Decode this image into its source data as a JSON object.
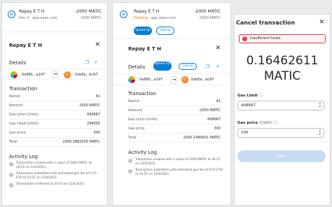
{
  "header": {
    "title": "Repay E T H",
    "amount": "-2000 MATIC",
    "date_site": "Dec 4 · app.aave.com",
    "sub_amount": "-2000 MATIC",
    "pending": "Pending",
    "site": "app.aave.com",
    "speed_up": "Speed Up",
    "cancel": "Cancel"
  },
  "details": {
    "title": "Repay E T H",
    "section": "Details",
    "from": "0x880...a197",
    "to": "0xbEa...dc97",
    "speed_up": "Speed Up",
    "cancel": "Cancel"
  },
  "transaction": {
    "title": "Transaction",
    "rows": [
      {
        "label": "Nonce",
        "value": "41"
      },
      {
        "label": "Amount",
        "value": "-2000 MATIC"
      },
      {
        "label": "Gas Limit (Units)",
        "value": "499667"
      },
      {
        "label": "Gas Used (Units)",
        "value": "294005"
      },
      {
        "label": "Gas price",
        "value": "300"
      },
      {
        "label": "Total",
        "value": "2000.0882035 MATIC"
      }
    ],
    "rows_p2": [
      {
        "label": "Nonce",
        "value": "41"
      },
      {
        "label": "Amount",
        "value": "-2000 MATIC"
      },
      {
        "label": "Gas Limit (Units)",
        "value": "499667"
      },
      {
        "label": "Gas price",
        "value": "300"
      },
      {
        "label": "Total",
        "value": "2000.1499601 MATIC"
      }
    ]
  },
  "activity": {
    "title": "Activity Log",
    "p1": [
      "Transaction created with a value of 2000 MATIC at 24:51 on 12/4/2021.",
      "Transaction submitted with estimated gas fee of 0.15 ETH at 24:51 on 12/4/2021.",
      "Transaction confirmed at 24:53 on 12/4/2021."
    ],
    "p2": [
      "Transaction created with a value of 2000 MATIC at 24:51 on 12/4/2021.",
      "Transaction submitted with estimated gas fee of 0.15 ETH at 24:51 on 12/4/2021."
    ]
  },
  "cancel_tx": {
    "title": "Cancel transaction",
    "error": "Insufficient funds.",
    "amount": "0.16462611",
    "currency": "MATIC",
    "gas_limit_label": "Gas Limit",
    "gas_limit_value": "498667",
    "gas_price_label": "Gas price",
    "gas_price_unit": "(GWEI)",
    "gas_price_value": "330",
    "save": "Save"
  },
  "colors": {
    "accent": "#037dd6",
    "error": "#d73a49",
    "pending": "#f66a0a"
  }
}
